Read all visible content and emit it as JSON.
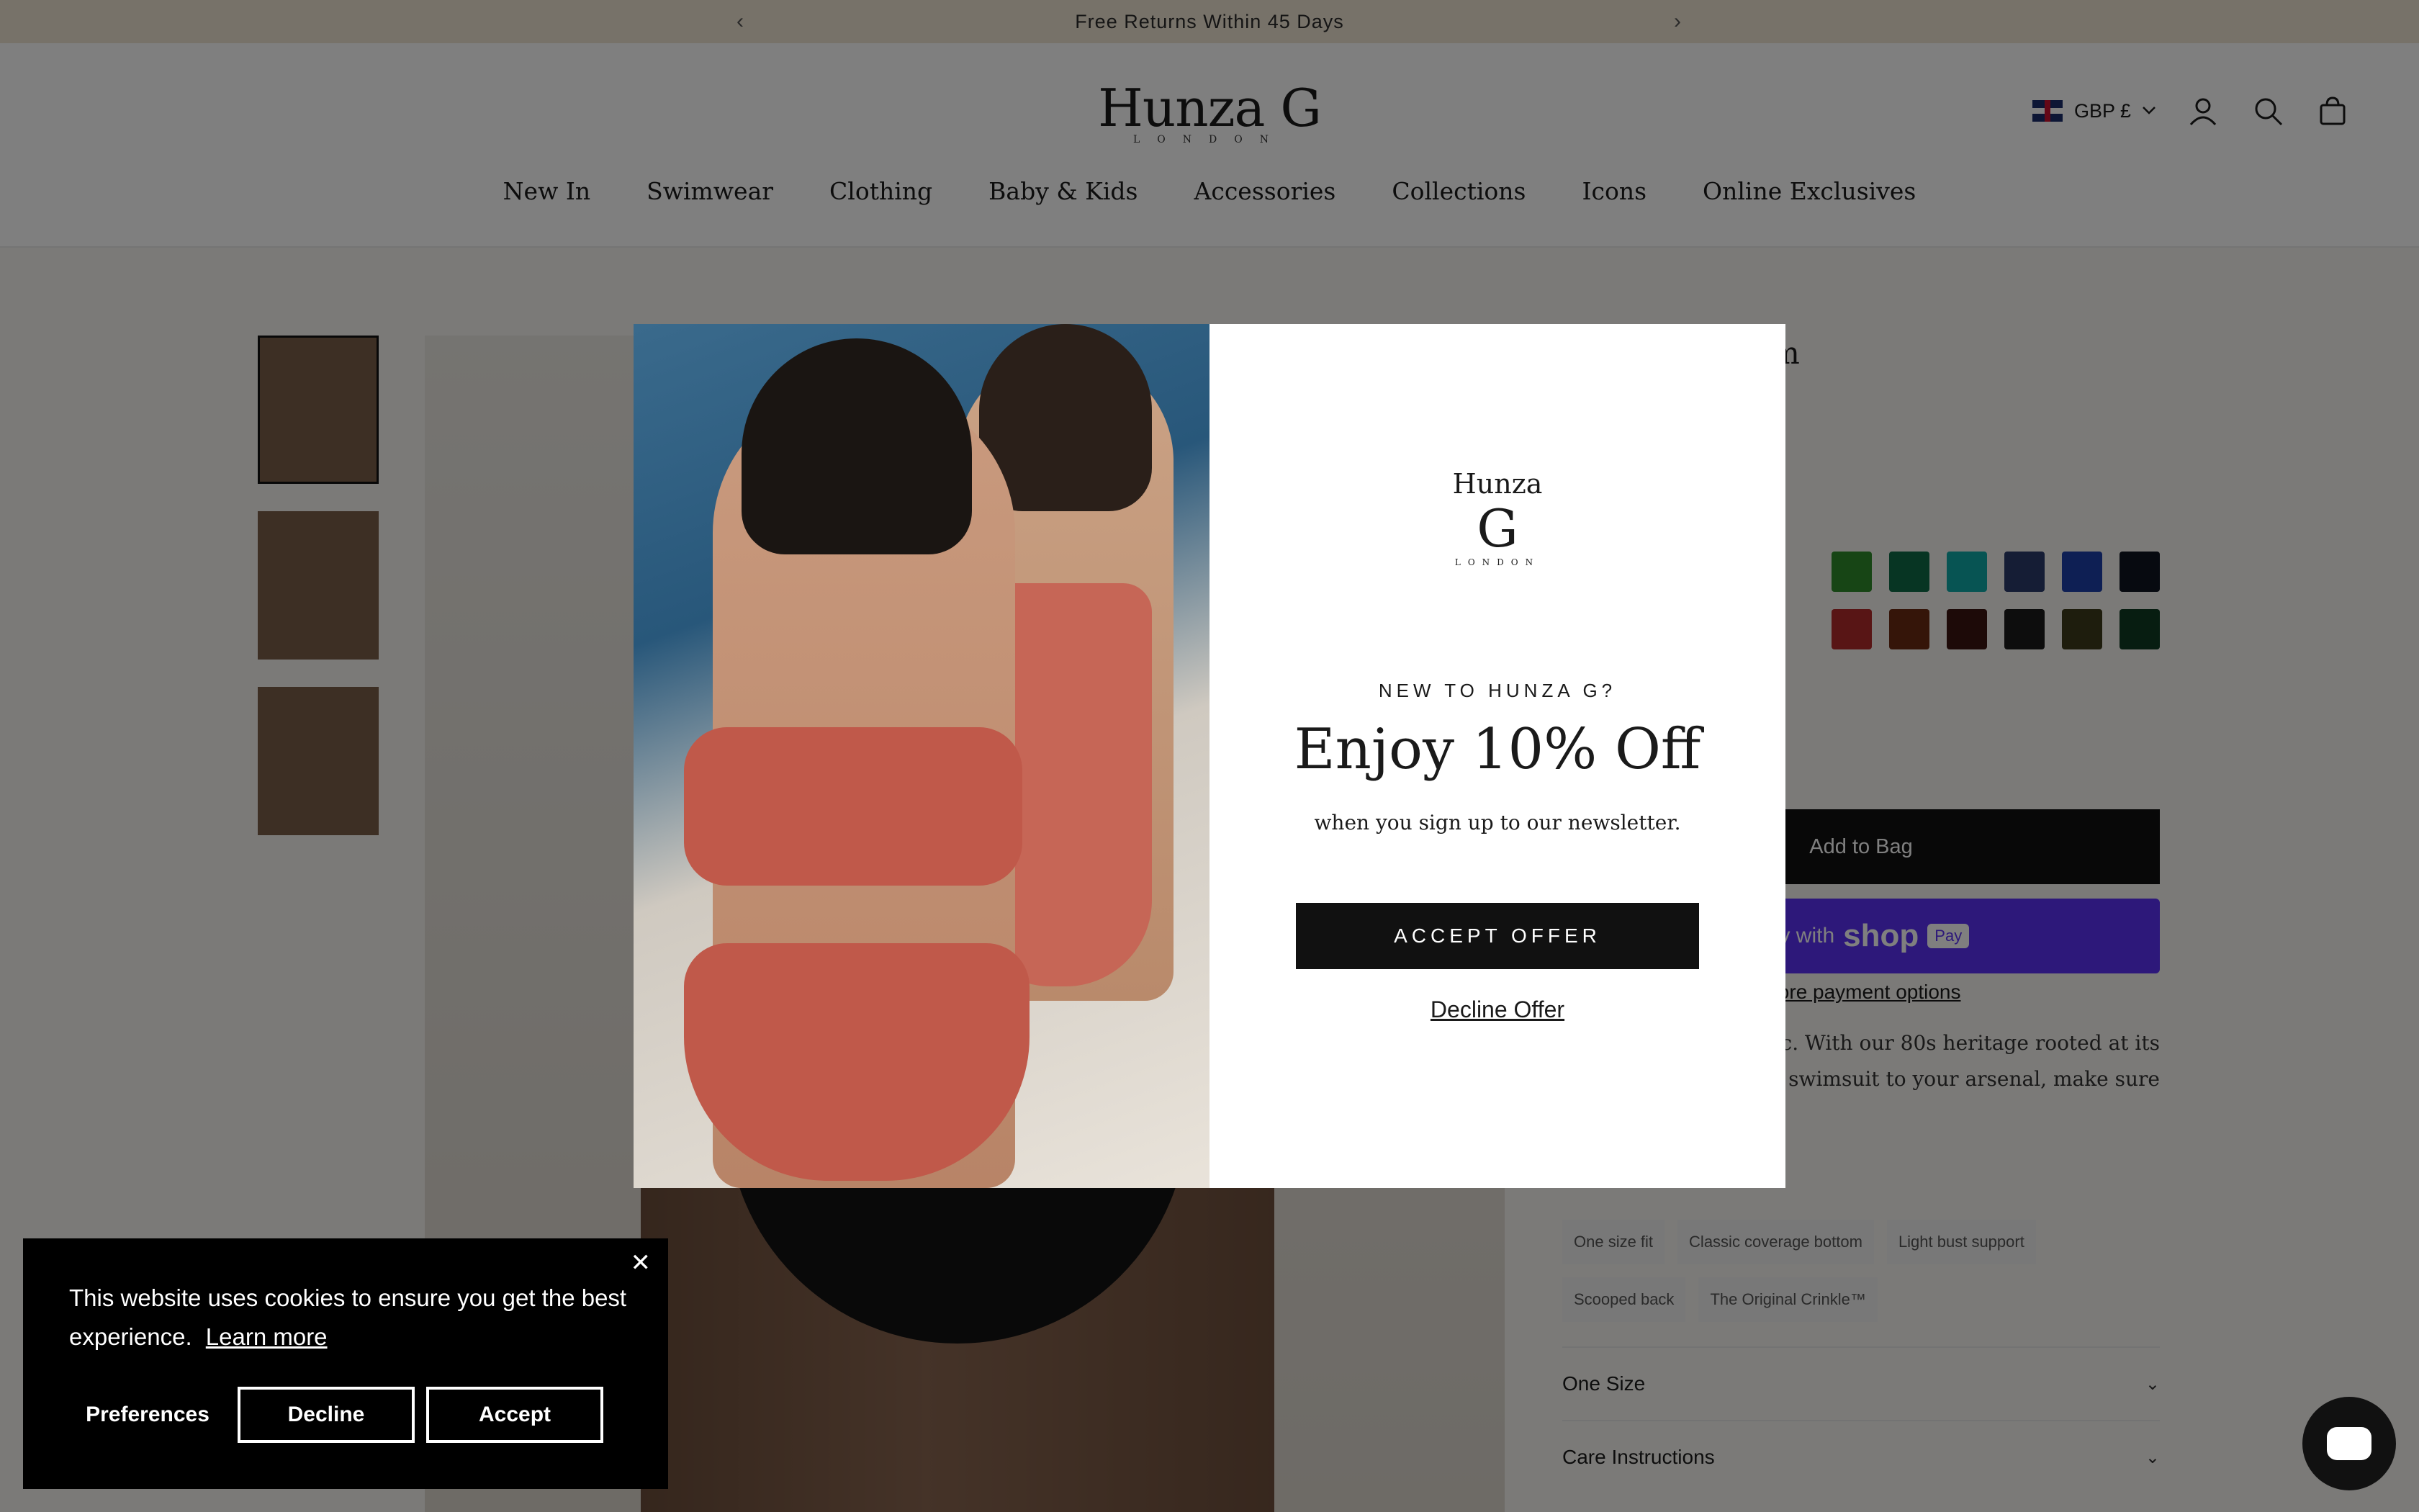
{
  "announcement": {
    "text": "Free Returns Within 45 Days",
    "prev_icon": "chevron-left-icon",
    "next_icon": "chevron-right-icon"
  },
  "header": {
    "logo_word": "Hunza G",
    "logo_sub": "LONDON",
    "currency": "GBP £",
    "nav": [
      "New In",
      "Swimwear",
      "Clothing",
      "Baby & Kids",
      "Accessories",
      "Collections",
      "Icons",
      "Online Exclusives"
    ]
  },
  "product": {
    "title_partial": "m",
    "swatch_colors_row1": [
      "#2f8a2a",
      "#0f6a47",
      "#0fa9a6",
      "#2b3b6a",
      "#1d3fa8",
      "#0f1520"
    ],
    "swatch_colors_row2": [
      "#b02a2a",
      "#6a2a12",
      "#3a1510",
      "#1a1a1a",
      "#3d3a1a",
      "#0f3a22"
    ],
    "add_to_bag": "Add to Bag",
    "shop_pay_prefix": "Buy with",
    "shop_pay_brand": "shop",
    "shop_pay_badge": "Pay",
    "more_options": "More payment options",
    "desc_line1": "assic. With our 80s heritage rooted at its",
    "desc_line2": "st one swimsuit to your arsenal, make sure",
    "tags": [
      "One size fit",
      "Classic coverage bottom",
      "Light bust support",
      "Scooped back",
      "The Original Crinkle™"
    ],
    "accordions": [
      "One Size",
      "Care Instructions"
    ]
  },
  "modal": {
    "logo_word": "Hunza",
    "logo_g": "G",
    "logo_sub": "LONDON",
    "eyebrow": "NEW TO HUNZA G?",
    "title": "Enjoy 10% Off",
    "subtitle": "when you sign up to our newsletter.",
    "accept": "ACCEPT OFFER",
    "decline": "Decline Offer"
  },
  "cookie": {
    "text": "This website uses cookies to ensure you get the best experience.",
    "learn_more": "Learn more",
    "preferences": "Preferences",
    "decline": "Decline",
    "accept": "Accept"
  }
}
